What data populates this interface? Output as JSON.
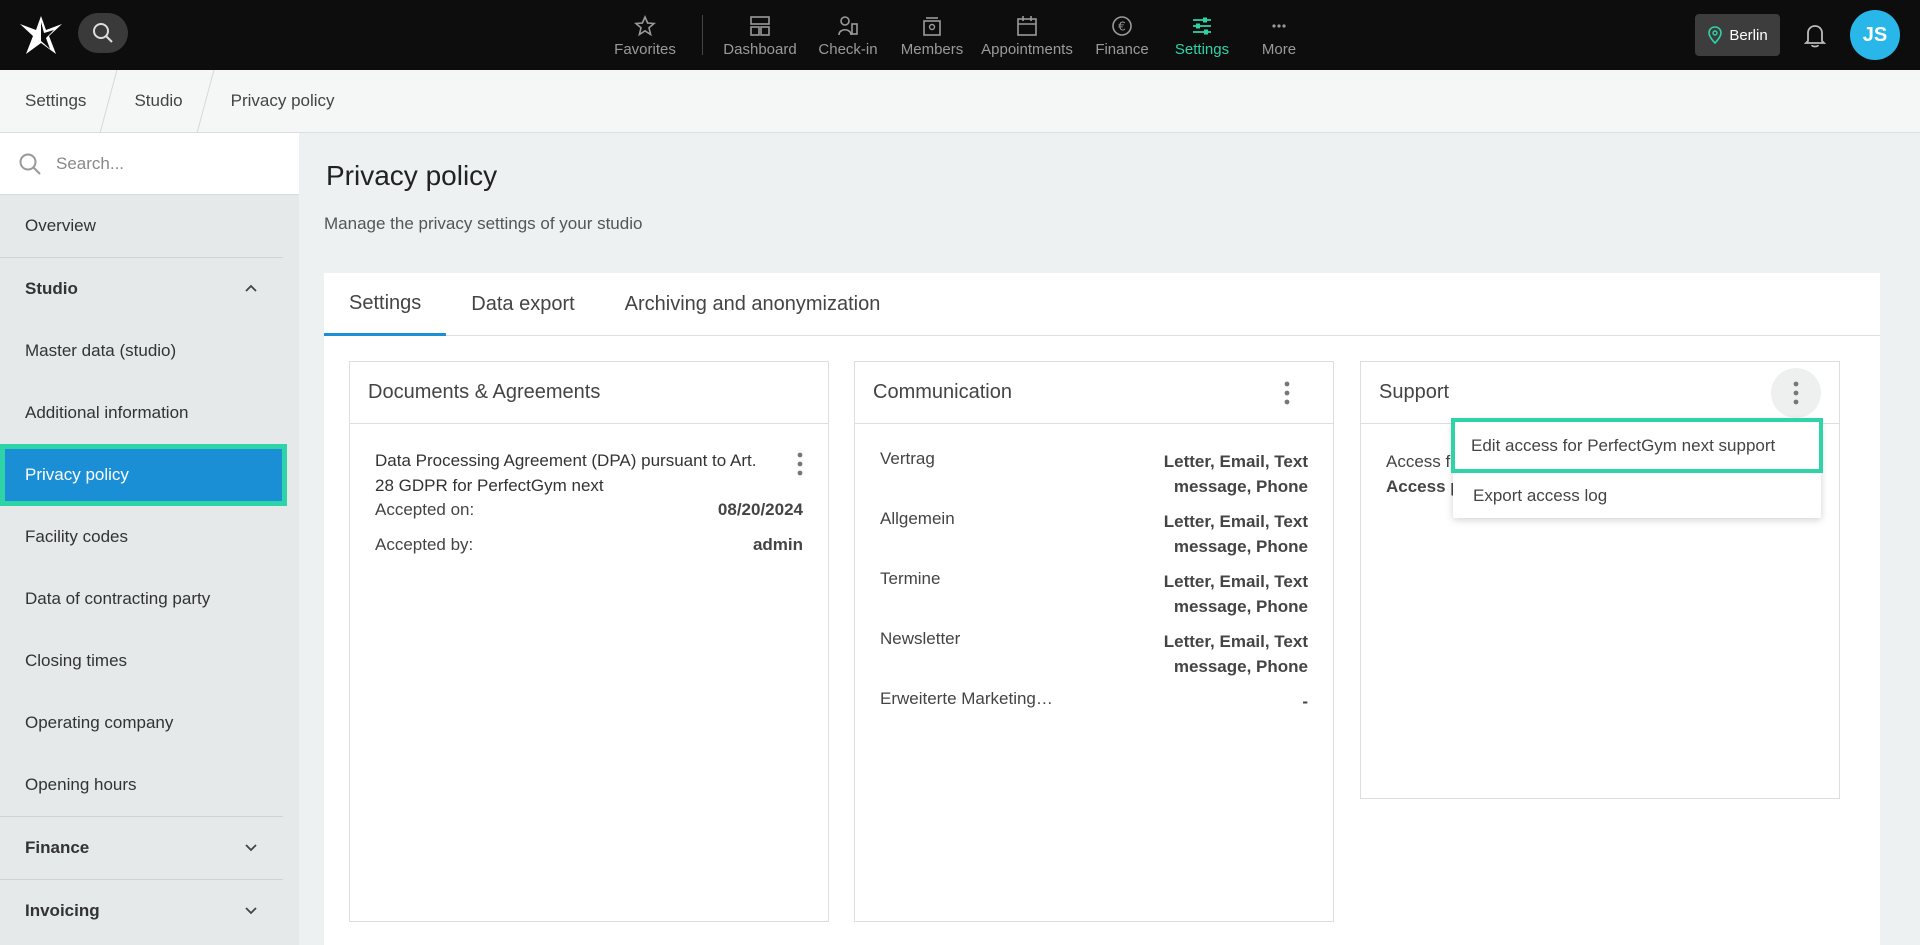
{
  "topbar": {
    "nav": [
      {
        "label": "Favorites",
        "icon": "star-icon"
      },
      {
        "label": "Dashboard",
        "icon": "dashboard-icon"
      },
      {
        "label": "Check-in",
        "icon": "check-in-icon"
      },
      {
        "label": "Members",
        "icon": "members-icon"
      },
      {
        "label": "Appointments",
        "icon": "calendar-icon"
      },
      {
        "label": "Finance",
        "icon": "euro-icon"
      },
      {
        "label": "Settings",
        "icon": "sliders-icon"
      },
      {
        "label": "More",
        "icon": "more-icon"
      }
    ],
    "active_nav": "Settings",
    "location": "Berlin",
    "avatar_initials": "JS",
    "accent_color": "#2fd3a8"
  },
  "breadcrumb": [
    "Settings",
    "Studio",
    "Privacy policy"
  ],
  "sidebar": {
    "search_placeholder": "Search...",
    "overview": "Overview",
    "studio_section": "Studio",
    "studio_items": [
      "Master data (studio)",
      "Additional information",
      "Privacy policy",
      "Facility codes",
      "Data of contracting party",
      "Closing times",
      "Operating company",
      "Opening hours"
    ],
    "active_item": "Privacy policy",
    "finance_section": "Finance",
    "invoicing_section": "Invoicing"
  },
  "main": {
    "title": "Privacy policy",
    "subtitle": "Manage the privacy settings of your studio",
    "tabs": [
      "Settings",
      "Data export",
      "Archiving and anonymization"
    ],
    "active_tab": "Settings"
  },
  "documents": {
    "title": "Documents & Agreements",
    "doc_title": "Data Processing Agreement (DPA) pursuant to Art. 28 GDPR for PerfectGym next",
    "accepted_on_label": "Accepted on:",
    "accepted_on_value": "08/20/2024",
    "accepted_by_label": "Accepted by:",
    "accepted_by_value": "admin"
  },
  "communication": {
    "title": "Communication",
    "rows": [
      {
        "key": "Vertrag",
        "value": "Letter, Email, Text message, Phone"
      },
      {
        "key": "Allgemein",
        "value": "Letter, Email, Text message, Phone"
      },
      {
        "key": "Termine",
        "value": "Letter, Email, Text message, Phone"
      },
      {
        "key": "Newsletter",
        "value": "Letter, Email, Text message, Phone"
      },
      {
        "key": "Erweiterte Marketing…",
        "value": "-"
      }
    ]
  },
  "support": {
    "title": "Support",
    "line1": "Access f",
    "line2": "Access p",
    "menu": [
      "Edit access for PerfectGym next support",
      "Export access log"
    ]
  }
}
